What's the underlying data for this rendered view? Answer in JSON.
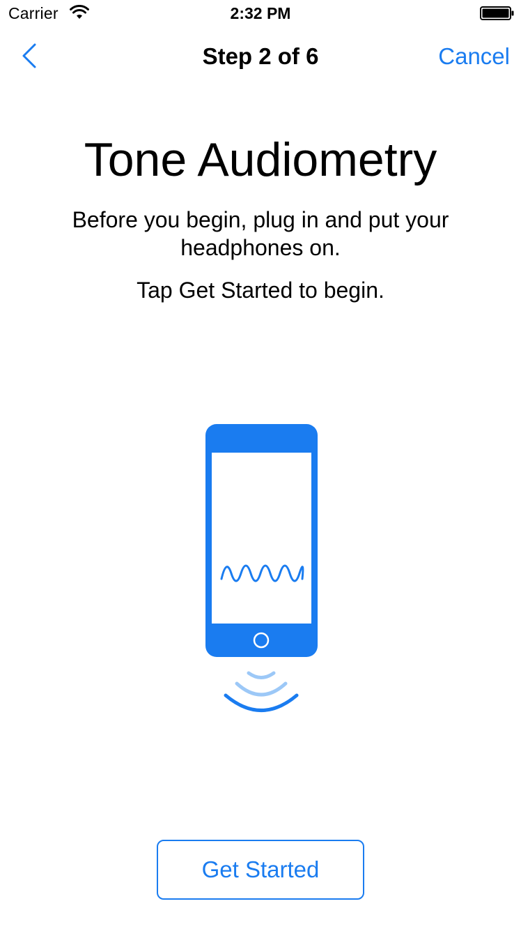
{
  "status_bar": {
    "carrier": "Carrier",
    "time": "2:32 PM"
  },
  "nav": {
    "title": "Step 2 of 6",
    "cancel_label": "Cancel",
    "back_icon": "chevron-left-icon"
  },
  "content": {
    "headline": "Tone Audiometry",
    "instruction": "Before you begin, plug in and put your headphones on.",
    "tap_instruction": "Tap Get Started to begin."
  },
  "illustration": {
    "icon": "phone-with-sound-wave-illustration"
  },
  "footer": {
    "get_started_label": "Get Started"
  },
  "colors": {
    "accent": "#1a7cf0",
    "illustration_blue": "#1a7cf0",
    "illustration_light_blue": "#9cc8f7",
    "text": "#000000",
    "background": "#ffffff"
  }
}
